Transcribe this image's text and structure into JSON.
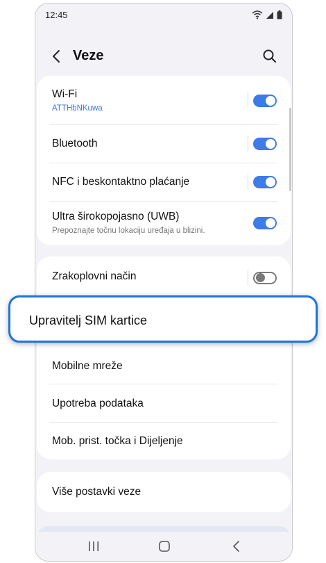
{
  "status_bar": {
    "time": "12:45"
  },
  "header": {
    "title": "Veze"
  },
  "card1": {
    "wifi": {
      "label": "Wi-Fi",
      "network": "ATTHbNKuwa",
      "enabled": true
    },
    "bluetooth": {
      "label": "Bluetooth",
      "enabled": true
    },
    "nfc": {
      "label": "NFC i beskontaktno plaćanje",
      "enabled": true
    },
    "uwb": {
      "label": "Ultra širokopojasno (UWB)",
      "description": "Prepoznajte točnu lokaciju uređaja u blizini.",
      "enabled": true
    }
  },
  "card2": {
    "airplane": {
      "label": "Zrakoplovni način",
      "enabled": false
    },
    "sim_manager": {
      "label": "Upravitelj SIM kartice"
    },
    "mobile_networks": {
      "label": "Mobilne mreže"
    },
    "data_usage": {
      "label": "Upotreba podataka"
    },
    "hotspot": {
      "label": "Mob. prist. točka i Dijeljenje"
    }
  },
  "card3": {
    "more": {
      "label": "Više postavki veze"
    }
  },
  "colors": {
    "accent": "#3d7be6",
    "callout_border": "#1e74d9",
    "background": "#f2f2f7"
  }
}
